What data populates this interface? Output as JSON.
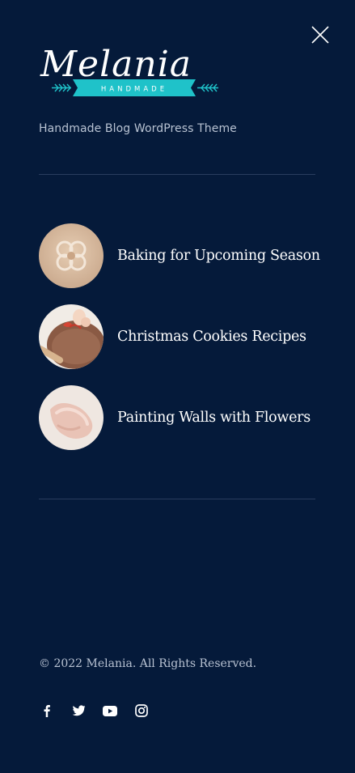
{
  "header": {
    "close_icon": "close-icon"
  },
  "branding": {
    "logo_text": "Melania",
    "logo_ribbon": "HANDMADE",
    "tagline": "Handmade Blog WordPress Theme",
    "accent_color": "#1fc2c9"
  },
  "posts": [
    {
      "title": "Baking for Upcoming Season",
      "image": "dough-shape-thumbnail"
    },
    {
      "title": "Christmas Cookies Recipes",
      "image": "cookie-cutting-thumbnail"
    },
    {
      "title": "Painting Walls with Flowers",
      "image": "paint-swatch-thumbnail"
    }
  ],
  "footer": {
    "copyright": "© 2022 Melania. All Rights Reserved.",
    "social": [
      {
        "icon": "facebook-icon"
      },
      {
        "icon": "twitter-icon"
      },
      {
        "icon": "youtube-icon"
      },
      {
        "icon": "instagram-icon"
      }
    ]
  },
  "colors": {
    "background": "#051a3a",
    "text": "#ffffff",
    "muted_text": "#b8c2d2",
    "divider": "#2a3d5e"
  }
}
